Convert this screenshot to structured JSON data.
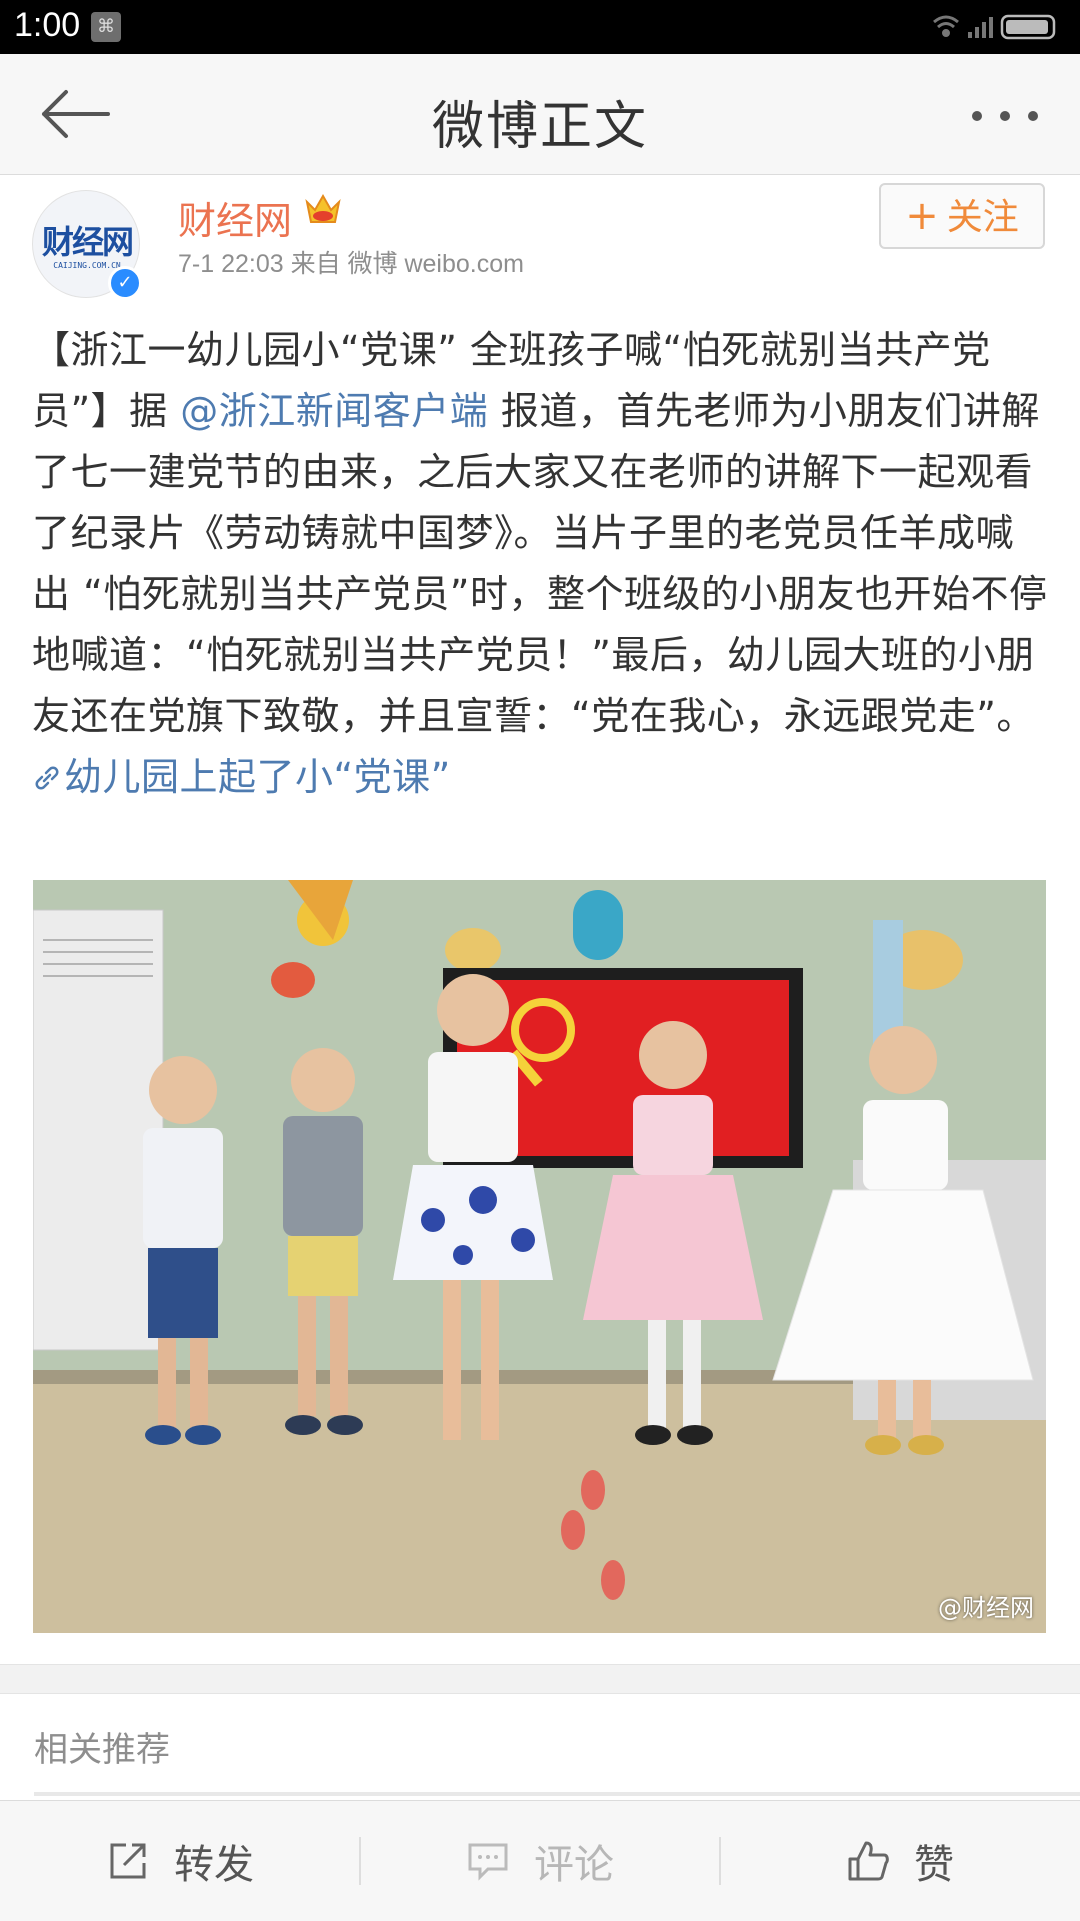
{
  "status_bar": {
    "time": "1:00"
  },
  "header": {
    "title": "微博正文"
  },
  "post": {
    "author": {
      "name": "财经网",
      "avatar_text": "财经网",
      "avatar_subtext": "CAIJING.COM.CN"
    },
    "meta": "7-1 22:03   来自 微博 weibo.com",
    "follow_label": "关注",
    "text": {
      "part1": "【浙江一幼儿园小“党课” 全班孩子喊“怕死就别当共产党员”】据 ",
      "mention": "@浙江新闻客户端",
      "part2": " 报道，首先老师为小朋友们讲解了七一建党节的由来，之后大家又在老师的讲解下一起观看了纪录片《劳动铸就中国梦》。当片子里的老党员任羊成喊出 “怕死就别当共产党员”时，整个班级的小朋友也开始不停地喊道：“怕死就别当共产党员！”最后，幼儿园大班的小朋友还在党旗下致敬，并且宣誓：“党在我心，永远跟党走”。 ",
      "link": "幼儿园上起了小“党课”"
    },
    "image_watermark": "@财经网"
  },
  "related": {
    "label": "相关推荐"
  },
  "toolbar": {
    "repost": "转发",
    "comment": "评论",
    "like": "赞"
  },
  "colors": {
    "username": "#eb7350",
    "link": "#4e7bb0",
    "follow": "#f08a3a"
  }
}
